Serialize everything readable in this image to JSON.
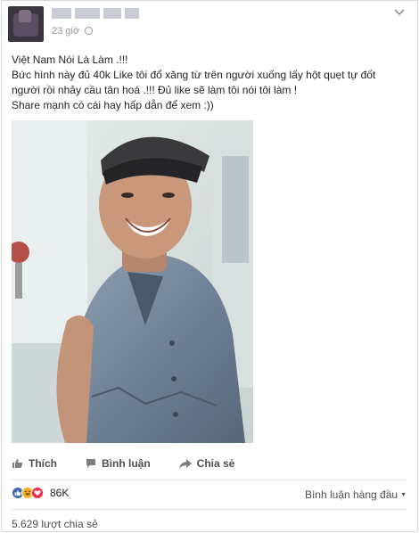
{
  "post": {
    "author_name": "",
    "timestamp": "23 giờ",
    "text_lines": [
      "Việt Nam Nói Là Làm .!!!",
      "Bức hình này đủ 40k Like tôi đổ xăng từ trên người xuống lấy hột quẹt tự đốt",
      "người rồi nhảy cầu tân hoá .!!! Đủ like sẽ làm tôi nói tôi làm !",
      "Share mạnh có cái hay hấp dẫn để xem :))"
    ]
  },
  "actions": {
    "like_label": "Thích",
    "comment_label": "Bình luận",
    "share_label": "Chia sẻ"
  },
  "reactions": {
    "count": "86K",
    "types": [
      "like-icon",
      "haha-icon",
      "love-icon"
    ],
    "colors": {
      "like": "#4267b2",
      "haha": "#f7b125",
      "love": "#f0284a"
    }
  },
  "comments_sort": {
    "label": "Bình luận hàng đầu"
  },
  "shares": {
    "label": "5.629 lượt chia sẻ"
  },
  "icons": [
    "avatar",
    "globe-icon",
    "chevron-down-icon",
    "thumb-up-icon",
    "comment-icon",
    "share-arrow-icon",
    "caret-down-icon"
  ]
}
